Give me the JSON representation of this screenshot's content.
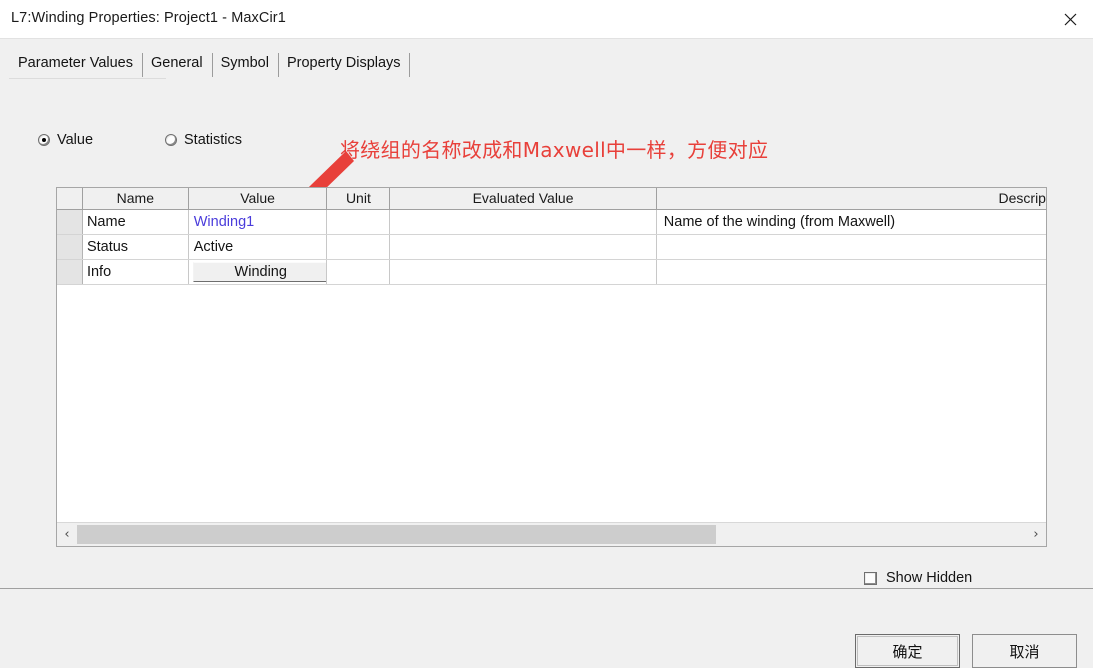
{
  "window": {
    "title": "L7:Winding Properties: Project1 - MaxCir1",
    "close_icon": "close-icon"
  },
  "tabs": [
    {
      "label": "Parameter Values",
      "active": true
    },
    {
      "label": "General",
      "active": false
    },
    {
      "label": "Symbol",
      "active": false
    },
    {
      "label": "Property Displays",
      "active": false
    }
  ],
  "mode_radios": [
    {
      "label": "Value",
      "selected": true
    },
    {
      "label": "Statistics",
      "selected": false
    }
  ],
  "annotation": {
    "text": "将绕组的名称改成和Maxwell中一样，方便对应",
    "color": "#e8403a",
    "arrow_icon": "arrow-pointer-icon"
  },
  "grid": {
    "columns": [
      {
        "key": "gutter",
        "label": ""
      },
      {
        "key": "name",
        "label": "Name"
      },
      {
        "key": "value",
        "label": "Value"
      },
      {
        "key": "unit",
        "label": "Unit"
      },
      {
        "key": "eval",
        "label": "Evaluated Value"
      },
      {
        "key": "desc",
        "label": "Descrip"
      }
    ],
    "rows": [
      {
        "name": "Name",
        "value": "Winding1",
        "value_kind": "link",
        "unit": "",
        "eval": "",
        "desc": "Name of the winding (from Maxwell)"
      },
      {
        "name": "Status",
        "value": "Active",
        "value_kind": "text",
        "unit": "",
        "eval": "",
        "desc": ""
      },
      {
        "name": "Info",
        "value": "Winding",
        "value_kind": "button",
        "unit": "",
        "eval": "",
        "desc": ""
      }
    ]
  },
  "scrollbar": {
    "left_arrow": "‹",
    "right_arrow": "›",
    "thumb_fraction": 0.67
  },
  "show_hidden": {
    "label": "Show Hidden",
    "checked": false
  },
  "footer": {
    "ok_label": "确定",
    "cancel_label": "取消"
  },
  "colors": {
    "accent_link": "#4a3cdb",
    "annotation_red": "#e8403a",
    "dialog_bg": "#f0f0f0",
    "grid_bg": "#ffffff"
  }
}
